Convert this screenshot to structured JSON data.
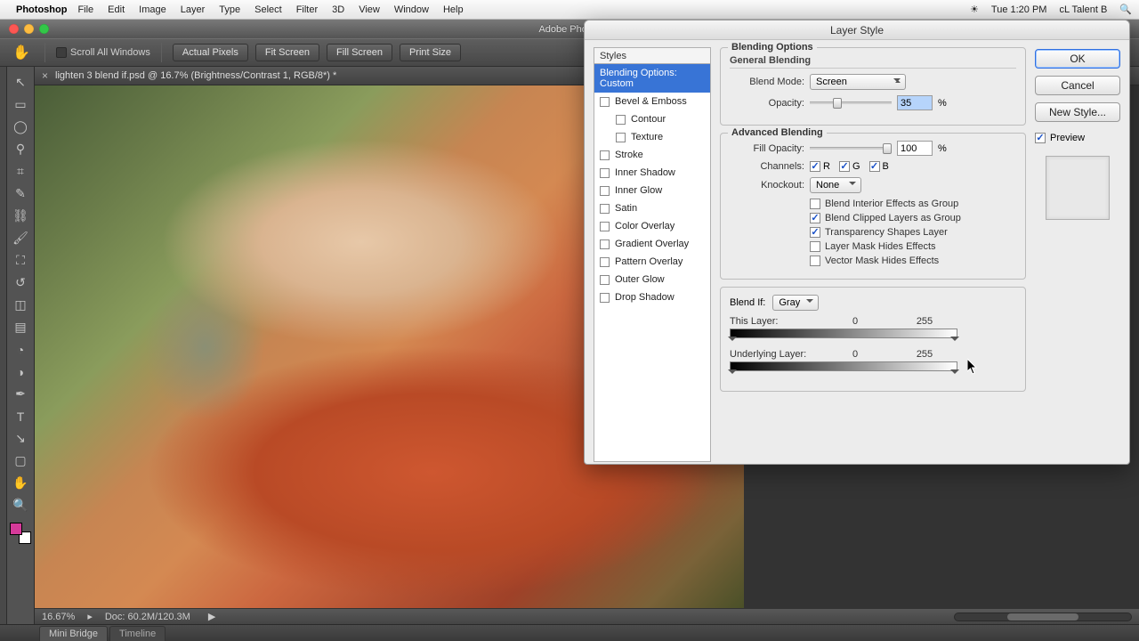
{
  "menubar": {
    "app": "Photoshop",
    "items": [
      "File",
      "Edit",
      "Image",
      "Layer",
      "Type",
      "Select",
      "Filter",
      "3D",
      "View",
      "Window",
      "Help"
    ],
    "clock": "Tue 1:20 PM",
    "user": "cL Talent B"
  },
  "window": {
    "title": "Adobe Photos"
  },
  "optionsbar": {
    "scroll_all": "Scroll All Windows",
    "buttons": [
      "Actual Pixels",
      "Fit Screen",
      "Fill Screen",
      "Print Size"
    ]
  },
  "doc_tab": "lighten 3 blend if.psd @ 16.7% (Brightness/Contrast 1, RGB/8*) *",
  "statusbar": {
    "zoom": "16.67%",
    "docsize": "Doc: 60.2M/120.3M"
  },
  "bottom_tabs": [
    "Mini Bridge",
    "Timeline"
  ],
  "dialog": {
    "title": "Layer Style",
    "styles_header": "Styles",
    "selected_style": "Blending Options: Custom",
    "style_rows": [
      {
        "label": "Bevel & Emboss",
        "indent": false
      },
      {
        "label": "Contour",
        "indent": true
      },
      {
        "label": "Texture",
        "indent": true
      },
      {
        "label": "Stroke",
        "indent": false
      },
      {
        "label": "Inner Shadow",
        "indent": false
      },
      {
        "label": "Inner Glow",
        "indent": false
      },
      {
        "label": "Satin",
        "indent": false
      },
      {
        "label": "Color Overlay",
        "indent": false
      },
      {
        "label": "Gradient Overlay",
        "indent": false
      },
      {
        "label": "Pattern Overlay",
        "indent": false
      },
      {
        "label": "Outer Glow",
        "indent": false
      },
      {
        "label": "Drop Shadow",
        "indent": false
      }
    ],
    "blending_options": "Blending Options",
    "general_blending": "General Blending",
    "blend_mode_lbl": "Blend Mode:",
    "blend_mode": "Screen",
    "opacity_lbl": "Opacity:",
    "opacity": "35",
    "advanced_blending": "Advanced Blending",
    "fill_opacity_lbl": "Fill Opacity:",
    "fill_opacity": "100",
    "channels_lbl": "Channels:",
    "ch_r": "R",
    "ch_g": "G",
    "ch_b": "B",
    "knockout_lbl": "Knockout:",
    "knockout": "None",
    "adv_checks": [
      {
        "on": false,
        "label": "Blend Interior Effects as Group"
      },
      {
        "on": true,
        "label": "Blend Clipped Layers as Group"
      },
      {
        "on": true,
        "label": "Transparency Shapes Layer"
      },
      {
        "on": false,
        "label": "Layer Mask Hides Effects"
      },
      {
        "on": false,
        "label": "Vector Mask Hides Effects"
      }
    ],
    "blend_if_lbl": "Blend If:",
    "blend_if": "Gray",
    "this_layer_lbl": "This Layer:",
    "this_layer_lo": "0",
    "this_layer_hi": "255",
    "under_layer_lbl": "Underlying Layer:",
    "under_layer_lo": "0",
    "under_layer_hi": "255",
    "buttons": {
      "ok": "OK",
      "cancel": "Cancel",
      "newstyle": "New Style..."
    },
    "preview_lbl": "Preview",
    "pct": "%"
  }
}
